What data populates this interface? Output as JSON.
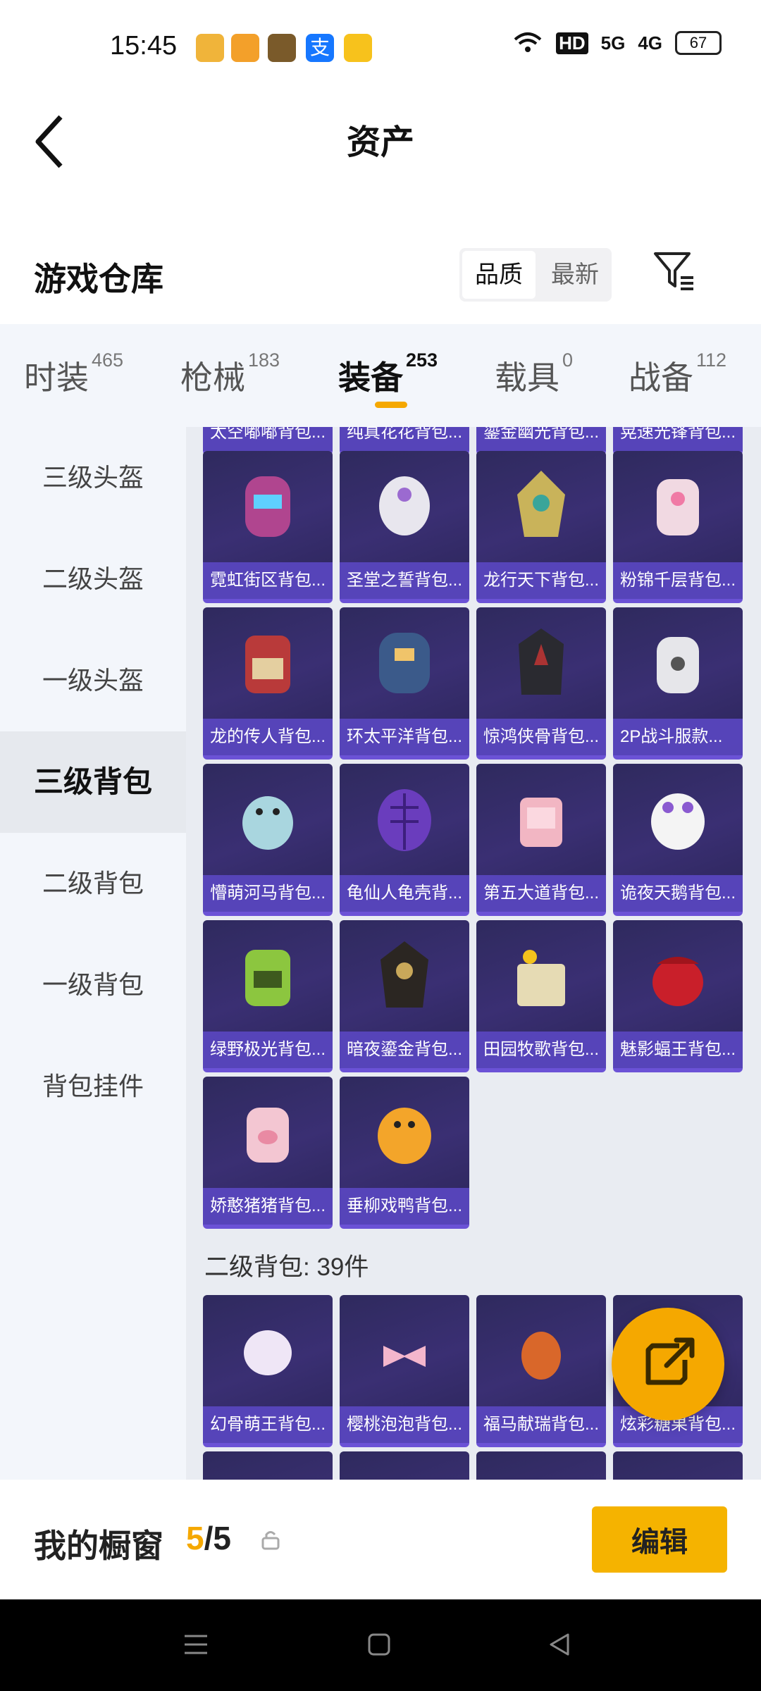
{
  "status_bar": {
    "time": "15:45",
    "signal1": "5G",
    "signal2": "4G",
    "hd": "HD",
    "battery": "67"
  },
  "header": {
    "title": "资产"
  },
  "store": {
    "title": "游戏仓库",
    "sort_options": [
      "品质",
      "最新"
    ],
    "sort_selected": "品质"
  },
  "tabs": [
    {
      "label": "时装",
      "count": "465"
    },
    {
      "label": "枪械",
      "count": "183"
    },
    {
      "label": "装备",
      "count": "253"
    },
    {
      "label": "载具",
      "count": "0"
    },
    {
      "label": "战备",
      "count": "112"
    }
  ],
  "active_tab": "装备",
  "sidebar": {
    "items": [
      "三级头盔",
      "二级头盔",
      "一级头盔",
      "三级背包",
      "二级背包",
      "一级背包",
      "背包挂件"
    ],
    "active": "三级背包"
  },
  "grid_top_partial": [
    "太空嘟嘟背包...",
    "纯真花花背包...",
    "鎏金幽光背包...",
    "晃速光锋背包..."
  ],
  "items_level3": [
    "霓虹街区背包...",
    "圣堂之誓背包...",
    "龙行天下背包...",
    "粉锦千层背包...",
    "龙的传人背包...",
    "环太平洋背包...",
    "惊鸿侠骨背包...",
    "2P战斗服款...",
    "懵萌河马背包...",
    "龟仙人龟壳背...",
    "第五大道背包...",
    "诡夜天鹅背包...",
    "绿野极光背包...",
    "暗夜鎏金背包...",
    "田园牧歌背包...",
    "魅影蝠王背包...",
    "娇憨猪猪背包...",
    "垂柳戏鸭背包..."
  ],
  "section_level2": {
    "title": "二级背包: 39件"
  },
  "items_level2": [
    "幻骨萌王背包...",
    "樱桃泡泡背包...",
    "福马献瑞背包...",
    "炫彩糖果背包..."
  ],
  "showcase": {
    "label": "我的橱窗",
    "current": "5",
    "separator": "/",
    "total": "5",
    "edit_label": "编辑"
  },
  "colors": {
    "accent": "#f5a800",
    "card_bg": "#2f2a5e",
    "card_label": "#5846be"
  }
}
